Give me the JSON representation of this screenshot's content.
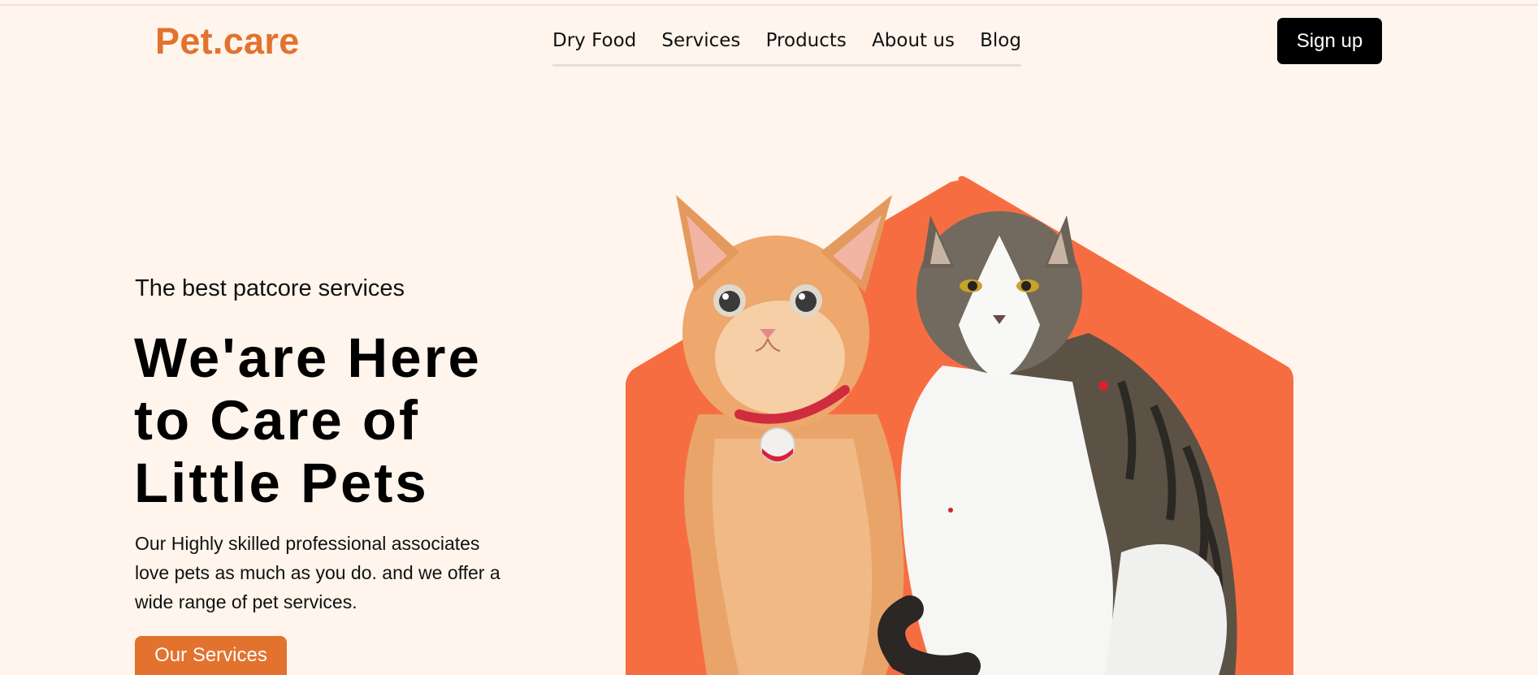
{
  "header": {
    "logo": "Pet.care",
    "nav": [
      {
        "label": "Dry Food"
      },
      {
        "label": "Services"
      },
      {
        "label": "Products"
      },
      {
        "label": "About us"
      },
      {
        "label": "Blog"
      }
    ],
    "signup_label": "Sign up"
  },
  "hero": {
    "tagline": "The best patcore services",
    "headline_lines": [
      "We'are Here",
      "to Care of",
      "Little Pets"
    ],
    "description": "Our Highly skilled professional associates love pets as much as you do. and we offer a wide range of pet services.",
    "cta_label": "Our Services"
  },
  "colors": {
    "brand": "#e2722d",
    "background": "#fff5ec",
    "hexagon": "#f76d42",
    "button_dark": "#000000"
  }
}
